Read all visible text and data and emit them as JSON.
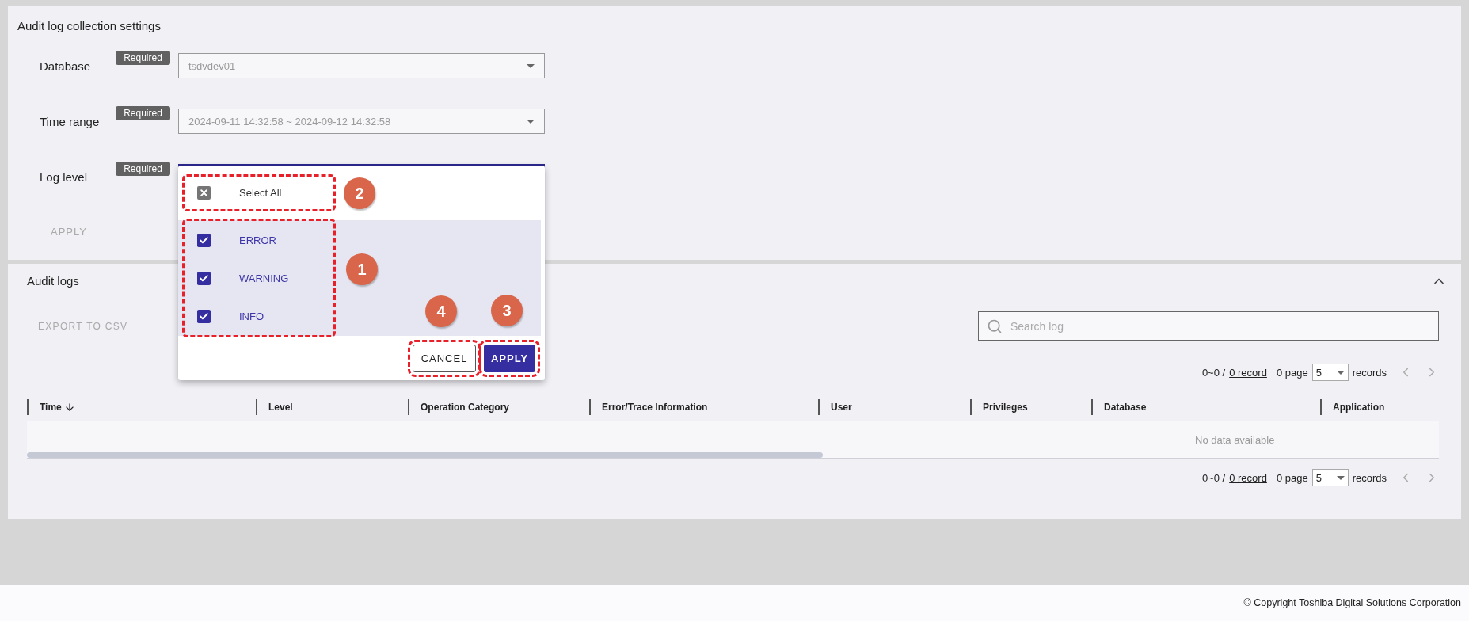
{
  "settings": {
    "title": "Audit log collection settings",
    "fields": [
      {
        "label": "Database",
        "badge": "Required",
        "value": "tsdvdev01",
        "focused": false,
        "open": false
      },
      {
        "label": "Time range",
        "badge": "Required",
        "value": "2024-09-11 14:32:58 ~ 2024-09-12 14:32:58",
        "focused": false,
        "open": false
      },
      {
        "label": "Log level",
        "badge": "Required",
        "focused": true,
        "open": true
      }
    ],
    "apply_button": {
      "label": "APPLY",
      "disabled": true
    }
  },
  "log_level_menu": {
    "select_all": {
      "label": "Select All",
      "checked": true,
      "callout": "2"
    },
    "items_callout": "1",
    "items": [
      {
        "label": "ERROR",
        "checked": true
      },
      {
        "label": "WARNING",
        "checked": true
      },
      {
        "label": "INFO",
        "checked": true
      }
    ],
    "cancel_button": {
      "label": "CANCEL",
      "callout": "4"
    },
    "apply_button": {
      "label": "APPLY",
      "callout": "3"
    }
  },
  "audit_logs": {
    "title": "Audit logs",
    "expanded": true,
    "export_button": {
      "label": "EXPORT TO CSV",
      "disabled": true
    },
    "search": {
      "placeholder": "Search log"
    },
    "pagination_top": {
      "range": "0~0 /",
      "total": "0 record",
      "page": "0 page",
      "per_page": "5",
      "unit": "records"
    },
    "table": {
      "columns": [
        {
          "label": "Time",
          "sorted": true
        },
        {
          "label": "Level",
          "sorted": false
        },
        {
          "label": "Operation Category",
          "sorted": false
        },
        {
          "label": "Error/Trace Information",
          "sorted": false
        },
        {
          "label": "User",
          "sorted": false
        },
        {
          "label": "Privileges",
          "sorted": false
        },
        {
          "label": "Database",
          "sorted": false
        },
        {
          "label": "Application",
          "sorted": false
        }
      ],
      "empty_text": "No data available"
    },
    "pagination_bottom": {
      "range": "0~0 /",
      "total": "0 record",
      "page": "0 page",
      "per_page": "5",
      "unit": "records"
    }
  },
  "footer": {
    "copyright": "© Copyright Toshiba Digital Solutions Corporation"
  }
}
